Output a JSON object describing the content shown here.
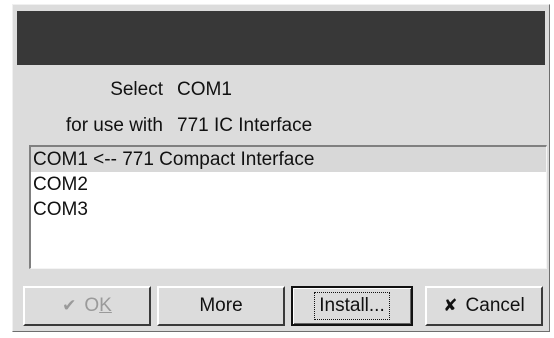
{
  "dialog": {
    "select_label": "Select",
    "select_value": "COM1",
    "use_label": "for use with",
    "use_value": "771 IC Interface"
  },
  "ports": [
    {
      "label": "COM1 <-- 771 Compact Interface",
      "selected": true
    },
    {
      "label": "COM2",
      "selected": false
    },
    {
      "label": "COM3",
      "selected": false
    }
  ],
  "buttons": {
    "ok_prefix": "O",
    "ok_underlined": "K",
    "ok_enabled": false,
    "more": "More",
    "install": "Install...",
    "cancel": "Cancel"
  },
  "icons": {
    "ok": "checkmark-icon",
    "cancel": "x-icon"
  }
}
